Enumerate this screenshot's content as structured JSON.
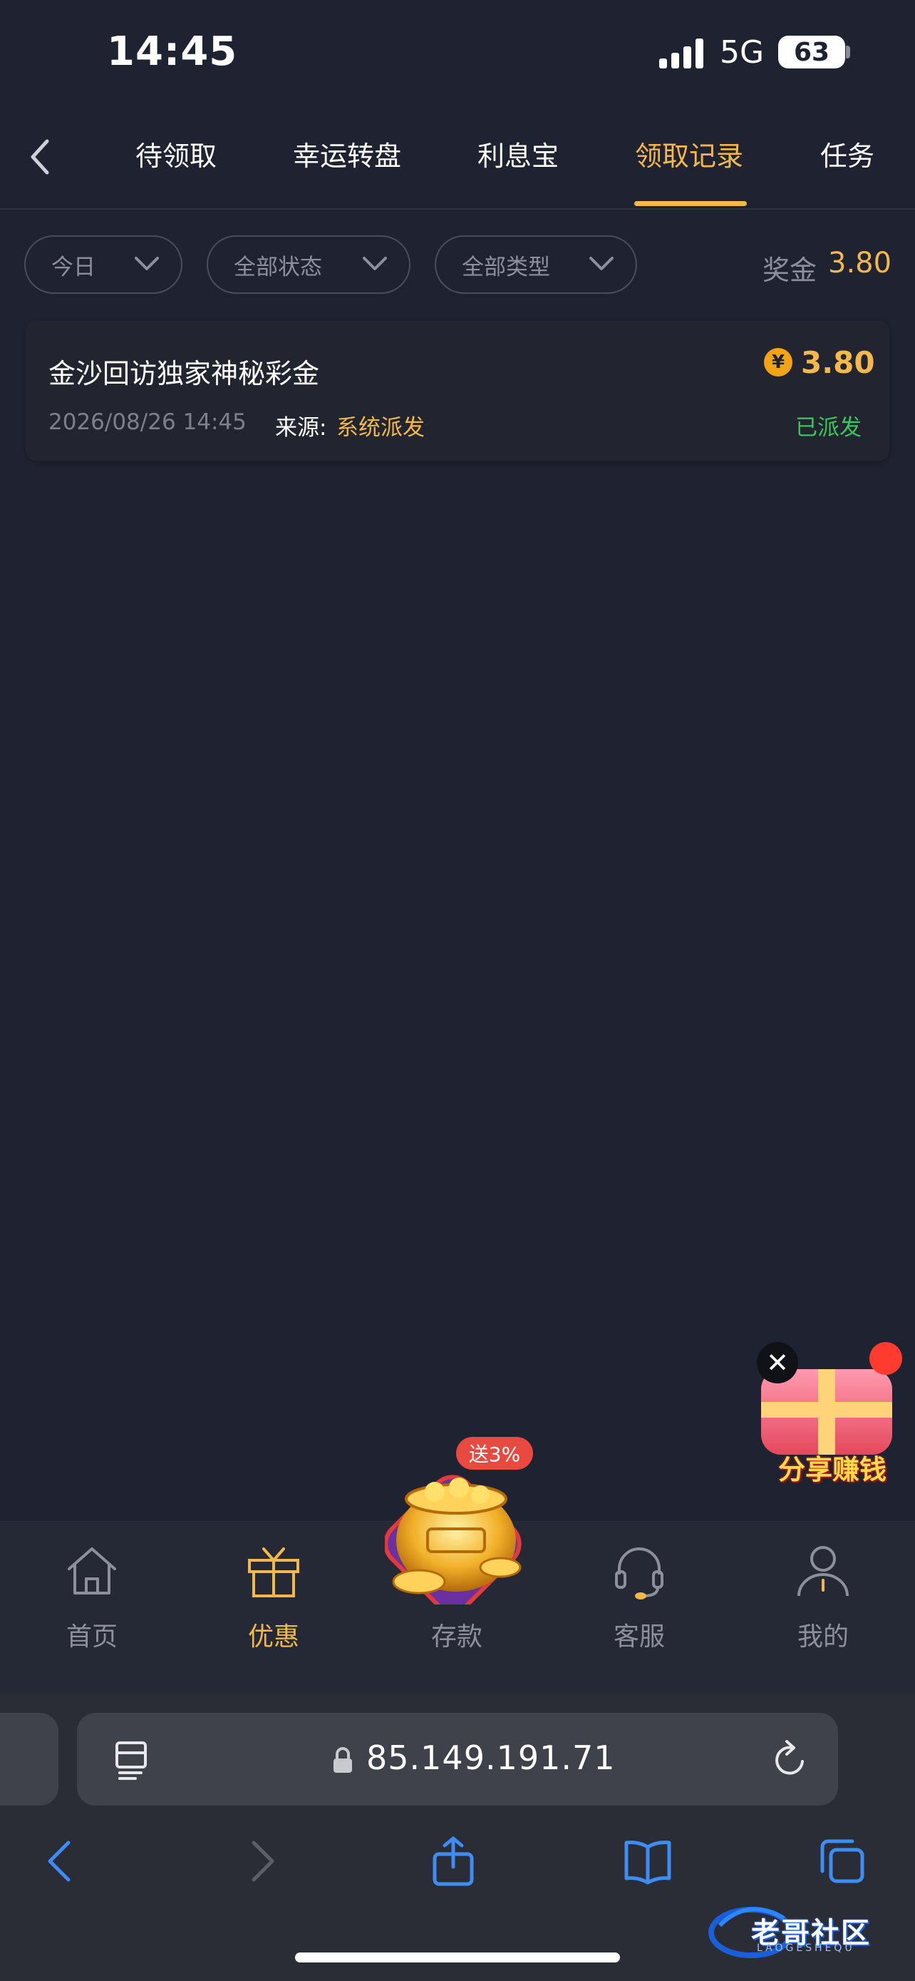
{
  "status_bar": {
    "time": "14:45",
    "network": "5G",
    "battery": "63"
  },
  "tabs": [
    {
      "label": "待领取"
    },
    {
      "label": "幸运转盘"
    },
    {
      "label": "利息宝"
    },
    {
      "label": "领取记录",
      "active": true
    },
    {
      "label": "任务"
    }
  ],
  "filters": {
    "date": "今日",
    "status": "全部状态",
    "type": "全部类型"
  },
  "bonus": {
    "label": "奖金",
    "value": "3.80"
  },
  "records": [
    {
      "title": "金沙回访独家神秘彩金",
      "time": "2026/08/26 14:45",
      "source_label": "来源:",
      "source": "系统派发",
      "currency_symbol": "¥",
      "amount": "3.80",
      "status": "已派发"
    }
  ],
  "share_widget": {
    "label": "分享赚钱",
    "close": "✕"
  },
  "deposit_badge": "送3%",
  "bottom_nav": [
    {
      "label": "首页",
      "icon": "home-icon"
    },
    {
      "label": "优惠",
      "icon": "gift-icon",
      "active": true
    },
    {
      "label": "存款",
      "icon": "pot-icon"
    },
    {
      "label": "客服",
      "icon": "headset-icon"
    },
    {
      "label": "我的",
      "icon": "user-icon"
    }
  ],
  "browser": {
    "url": "85.149.191.71"
  },
  "watermark": {
    "text": "老哥社区",
    "sub": "LAOGESHEQU"
  },
  "colors": {
    "background": "#1f2230",
    "accent": "#f2b84b",
    "success": "#3cc65a",
    "muted": "#8d909c"
  }
}
